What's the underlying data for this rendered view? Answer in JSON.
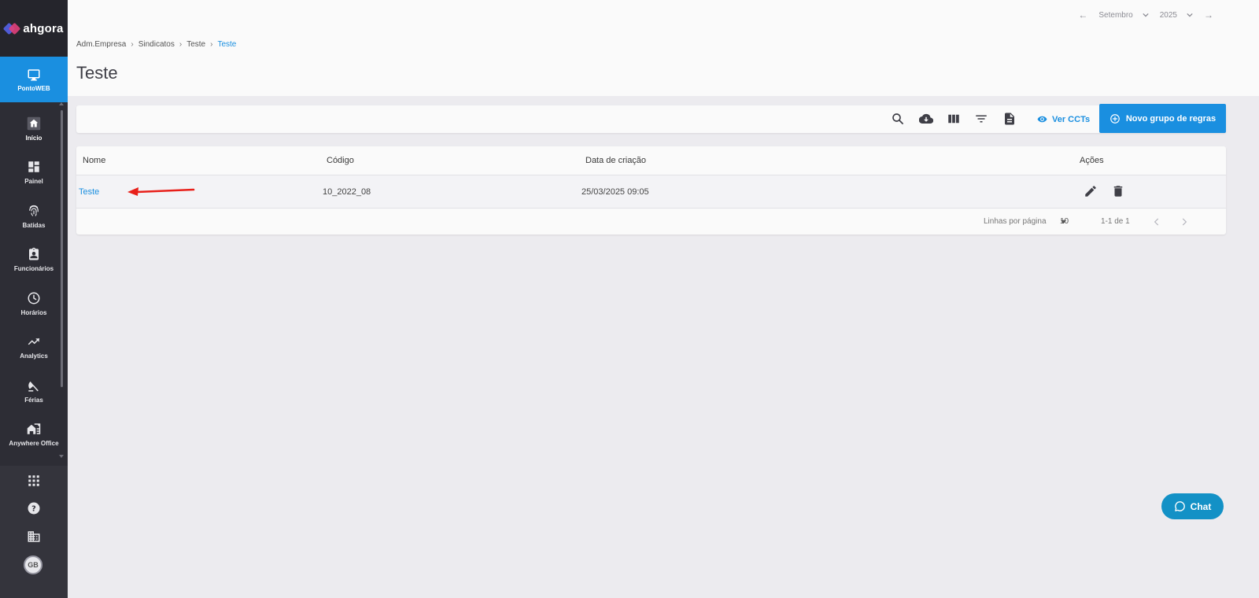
{
  "app": {
    "logo_text": "ahgora"
  },
  "sidebar": {
    "module_label": "PontoWEB",
    "items": [
      {
        "label": "Início",
        "icon": "home-icon"
      },
      {
        "label": "Painel",
        "icon": "dashboard-icon"
      },
      {
        "label": "Batidas",
        "icon": "fingerprint-icon"
      },
      {
        "label": "Funcionários",
        "icon": "badge-icon"
      },
      {
        "label": "Horários",
        "icon": "clock-icon"
      },
      {
        "label": "Analytics",
        "icon": "trending-icon"
      },
      {
        "label": "Férias",
        "icon": "umbrella-icon"
      },
      {
        "label": "Anywhere Office",
        "icon": "home-work-icon"
      }
    ],
    "bottom": {
      "avatar_initials": "GB"
    }
  },
  "header": {
    "period": {
      "month": "Setembro",
      "year": "2025"
    },
    "breadcrumb": [
      "Adm.Empresa",
      "Sindicatos",
      "Teste",
      "Teste"
    ],
    "title": "Teste"
  },
  "toolbar": {
    "ver_ccts_label": "Ver CCTs",
    "new_button_label": "Novo grupo de regras"
  },
  "table": {
    "columns": [
      "Nome",
      "Código",
      "Data de criação",
      "Ações"
    ],
    "rows": [
      {
        "nome": "Teste",
        "codigo": "10_2022_08",
        "data": "25/03/2025 09:05"
      }
    ],
    "footer": {
      "rows_per_page_label": "Linhas por página",
      "rows_per_page_value": "10",
      "range": "1-1 de 1"
    }
  },
  "chat": {
    "label": "Chat"
  },
  "colors": {
    "accent": "#1a8fe0",
    "sidebar": "#2d2d35",
    "annotation": "#e8201a",
    "chat": "#1391c6"
  }
}
